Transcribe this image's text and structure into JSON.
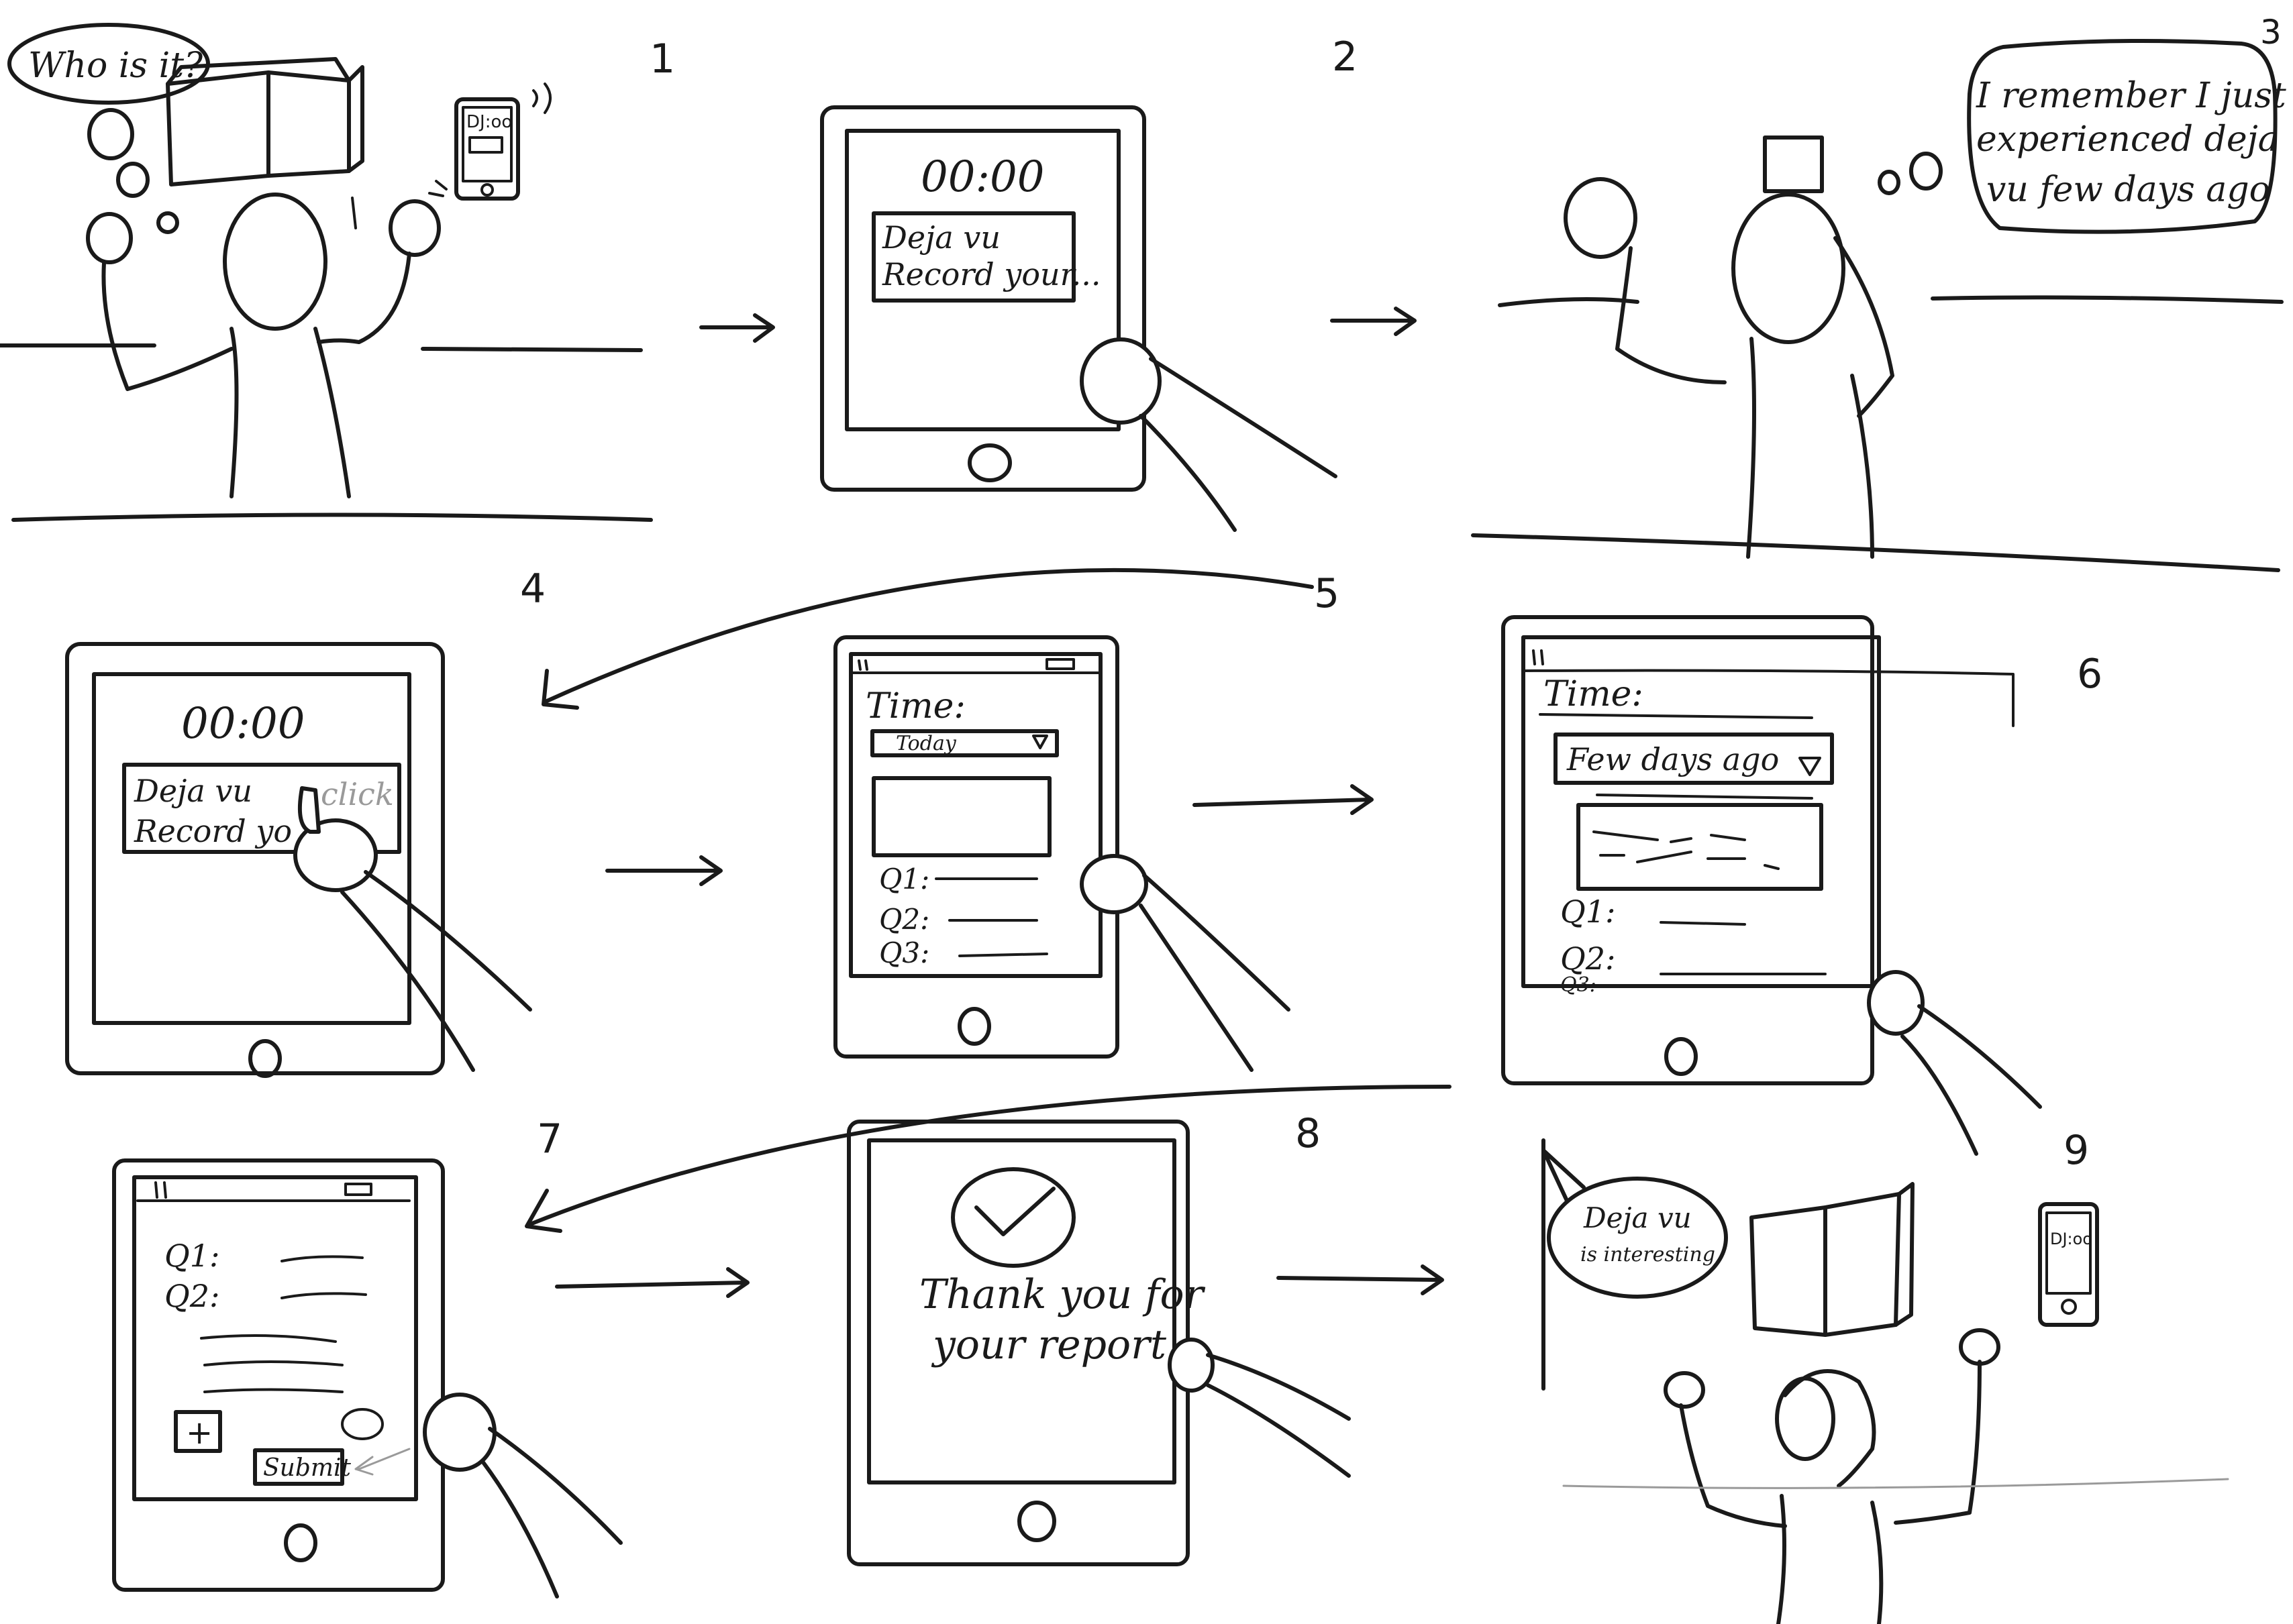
{
  "panels": [
    {
      "number": "1",
      "speech": "Who is it?",
      "phone_screen": "DJ:oo"
    },
    {
      "number": "2",
      "timer": "00:00",
      "notice_line1": "Deja vu",
      "notice_line2": "Record your..."
    },
    {
      "number": "3",
      "thought_line1": "I remember I just",
      "thought_line2": "experienced deja",
      "thought_line3": "vu few days ago"
    },
    {
      "number": "4",
      "timer": "00:00",
      "notice_line1": "Deja vu",
      "notice_line2": "Record yo",
      "action": "click"
    },
    {
      "number": "5",
      "time_label": "Time:",
      "dropdown_value": "Today",
      "q1": "Q1:",
      "q2": "Q2:",
      "q3": "Q3:"
    },
    {
      "number": "6",
      "time_label": "Time:",
      "dropdown_value": "Few days ago",
      "q1": "Q1:",
      "q2": "Q2:",
      "q3": "Q3:"
    },
    {
      "number": "7",
      "q1": "Q1:",
      "q2": "Q2:",
      "add": "+",
      "submit": "Submit"
    },
    {
      "number": "8",
      "thanks_line1": "Thank you for",
      "thanks_line2": "your report."
    },
    {
      "number": "9",
      "speech_line1": "Deja vu",
      "speech_line2": "is interesting",
      "phone_screen": "DJ:oo"
    }
  ],
  "colors": {
    "ink": "#1a1a1a",
    "paper": "#ffffff",
    "pencil": "#9a9a9a"
  }
}
